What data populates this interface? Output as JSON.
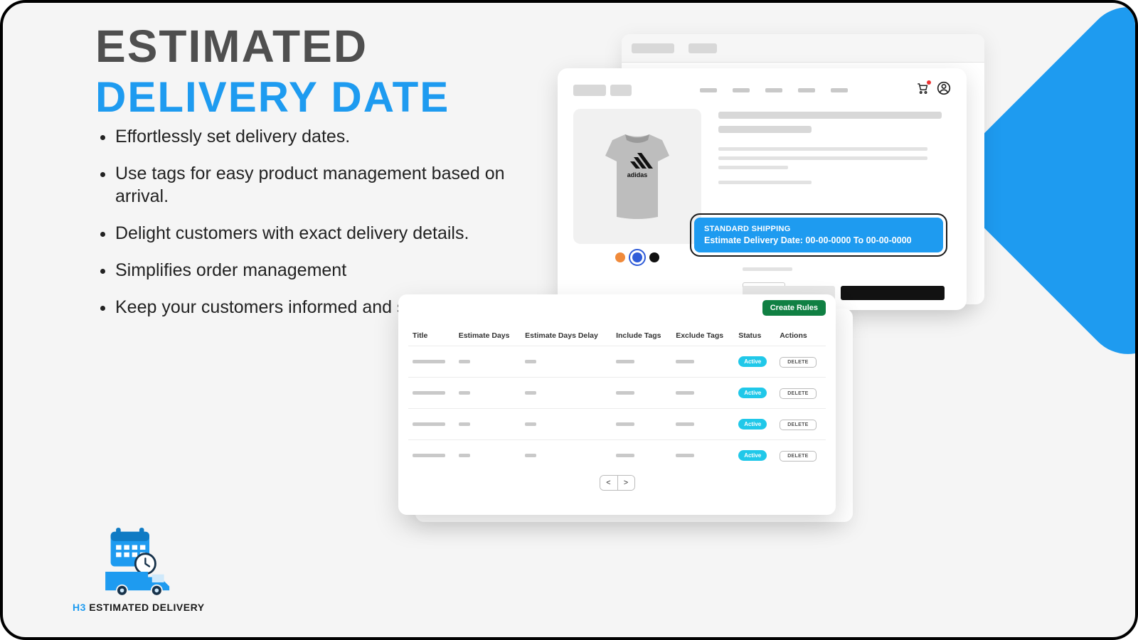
{
  "heading": {
    "line1": "ESTIMATED",
    "line2": "DELIVERY DATE"
  },
  "bullets": [
    "Effortlessly set delivery dates.",
    "Use tags for easy product management based on arrival.",
    "Delight customers with exact delivery details.",
    "Simplifies order management",
    "Keep your customers informed and satisfied"
  ],
  "logo": {
    "prefix": "H3",
    "rest": " ESTIMATED DELIVERY"
  },
  "shipping_banner": {
    "title": "STANDARD SHIPPING",
    "line": "Estimate Delivery Date: 00-00-0000 To 00-00-0000"
  },
  "rules": {
    "create_label": "Create Rules",
    "columns": [
      "Title",
      "Estimate Days",
      "Estimate Days Delay",
      "Include Tags",
      "Exclude Tags",
      "Status",
      "Actions"
    ],
    "status_label": "Active",
    "delete_label": "DELETE",
    "rows": 4,
    "pager_prev": "<",
    "pager_next": ">"
  },
  "colors": {
    "accent": "#1E9BF0",
    "success": "#108043",
    "badge": "#20C8E9"
  }
}
